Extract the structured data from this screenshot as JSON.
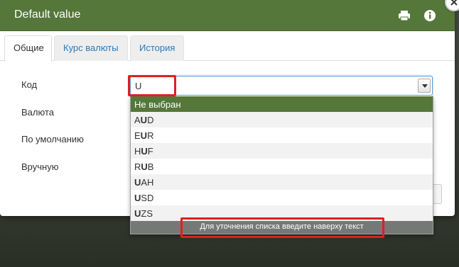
{
  "modal": {
    "title": "Default value",
    "icons": {
      "print": "print-icon",
      "info": "info-icon",
      "close": "close-icon"
    }
  },
  "tabs": [
    {
      "label": "Общие",
      "active": true
    },
    {
      "label": "Курс валюты",
      "active": false
    },
    {
      "label": "История",
      "active": false
    }
  ],
  "form": {
    "labels": [
      "Код",
      "Валюта",
      "По умолчанию",
      "Вручную"
    ],
    "code_select": {
      "value": "U",
      "options": [
        {
          "pre": "",
          "match": "",
          "post": "Не выбран"
        },
        {
          "pre": "A",
          "match": "U",
          "post": "D"
        },
        {
          "pre": "E",
          "match": "U",
          "post": "R"
        },
        {
          "pre": "H",
          "match": "U",
          "post": "F"
        },
        {
          "pre": "R",
          "match": "U",
          "post": "B"
        },
        {
          "pre": "",
          "match": "U",
          "post": "AH"
        },
        {
          "pre": "",
          "match": "U",
          "post": "SD"
        },
        {
          "pre": "",
          "match": "U",
          "post": "ZS"
        }
      ],
      "hint": "Для уточнения списка введите наверху текст"
    }
  },
  "colors": {
    "header": "#55773a",
    "selected_option": "#55773a",
    "highlight": "#e02020",
    "tab_link": "#2a7ab8"
  }
}
